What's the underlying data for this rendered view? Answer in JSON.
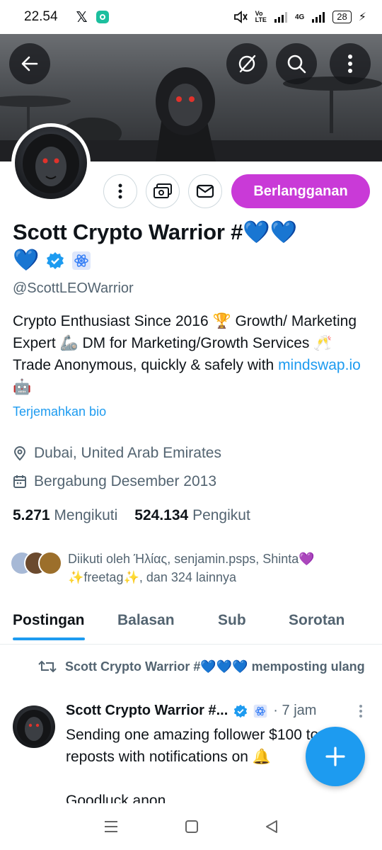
{
  "status_bar": {
    "time": "22.54",
    "network": "4G",
    "battery": "28"
  },
  "profile": {
    "subscribe_label": "Berlangganan",
    "name_line1": "Scott Crypto Warrior #💙💙",
    "name_line2_emoji": "💙",
    "handle": "@ScottLEOWarrior",
    "bio_part1": "Crypto Enthusiast Since 2016 🏆  Growth/ Marketing Expert 🦾  DM for Marketing/Growth Services 🥂Trade Anonymous, quickly & safely with ",
    "bio_link": "mindswap.io",
    "bio_part2": " 🤖",
    "translate_label": "Terjemahkan bio",
    "location": "Dubai, United Arab Emirates",
    "joined": "Bergabung Desember 2013",
    "following_count": "5.271",
    "following_label": "Mengikuti",
    "followers_count": "524.134",
    "followers_label": "Pengikut",
    "followed_by": "Diikuti oleh Ήλίας, senjamin.psps, Shinta💜✨freetag✨, dan 324 lainnya"
  },
  "tabs": [
    {
      "label": "Postingan"
    },
    {
      "label": "Balasan"
    },
    {
      "label": "Sub"
    },
    {
      "label": "Sorotan"
    }
  ],
  "post": {
    "repost_text": "Scott Crypto Warrior #💙💙💙 memposting ulang",
    "author": "Scott Crypto Warrior #...",
    "time": "· 7 jam",
    "body_line1": "Sending one amazing follower $100 to who",
    "body_line2": "reposts with notifications on 🔔",
    "body_line3": "Goodluck anon."
  },
  "colors": {
    "accent": "#1d9bf0",
    "subscribe": "#c93ad7",
    "muted": "#536471"
  },
  "icons": [
    "back-arrow-icon",
    "no-notifications-icon",
    "search-icon",
    "more-vertical-icon",
    "money-icon",
    "mail-icon",
    "location-pin-icon",
    "calendar-icon",
    "repost-icon",
    "verified-badge-icon",
    "atom-badge-icon",
    "plus-icon"
  ]
}
